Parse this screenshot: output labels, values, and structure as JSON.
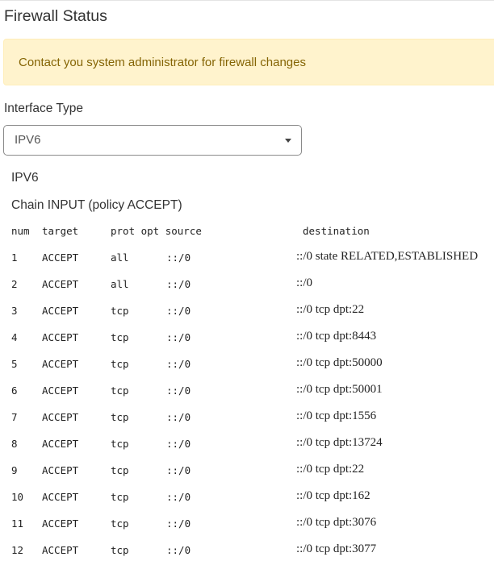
{
  "page_title": "Firewall Status",
  "alert": {
    "message": "Contact you system administrator for firewall changes"
  },
  "interface_type": {
    "label": "Interface Type",
    "selected": "IPV6"
  },
  "section_heading": "IPV6",
  "chain_heading": "Chain INPUT (policy ACCEPT)",
  "table": {
    "headers": {
      "num": "num",
      "target": "target",
      "prot_opt_source": "prot opt source",
      "destination": "destination"
    },
    "rows": [
      {
        "num": "1",
        "target": "ACCEPT",
        "prot": "all",
        "source": "::/0",
        "destination": "::/0 state RELATED,ESTABLISHED"
      },
      {
        "num": "2",
        "target": "ACCEPT",
        "prot": "all",
        "source": "::/0",
        "destination": "::/0"
      },
      {
        "num": "3",
        "target": "ACCEPT",
        "prot": "tcp",
        "source": "::/0",
        "destination": "::/0 tcp dpt:22"
      },
      {
        "num": "4",
        "target": "ACCEPT",
        "prot": "tcp",
        "source": "::/0",
        "destination": "::/0 tcp dpt:8443"
      },
      {
        "num": "5",
        "target": "ACCEPT",
        "prot": "tcp",
        "source": "::/0",
        "destination": "::/0 tcp dpt:50000"
      },
      {
        "num": "6",
        "target": "ACCEPT",
        "prot": "tcp",
        "source": "::/0",
        "destination": "::/0 tcp dpt:50001"
      },
      {
        "num": "7",
        "target": "ACCEPT",
        "prot": "tcp",
        "source": "::/0",
        "destination": "::/0 tcp dpt:1556"
      },
      {
        "num": "8",
        "target": "ACCEPT",
        "prot": "tcp",
        "source": "::/0",
        "destination": "::/0 tcp dpt:13724"
      },
      {
        "num": "9",
        "target": "ACCEPT",
        "prot": "tcp",
        "source": "::/0",
        "destination": "::/0 tcp dpt:22"
      },
      {
        "num": "10",
        "target": "ACCEPT",
        "prot": "tcp",
        "source": "::/0",
        "destination": "::/0 tcp dpt:162"
      },
      {
        "num": "11",
        "target": "ACCEPT",
        "prot": "tcp",
        "source": "::/0",
        "destination": "::/0 tcp dpt:3076"
      },
      {
        "num": "12",
        "target": "ACCEPT",
        "prot": "tcp",
        "source": "::/0",
        "destination": "::/0 tcp dpt:3077"
      }
    ]
  }
}
